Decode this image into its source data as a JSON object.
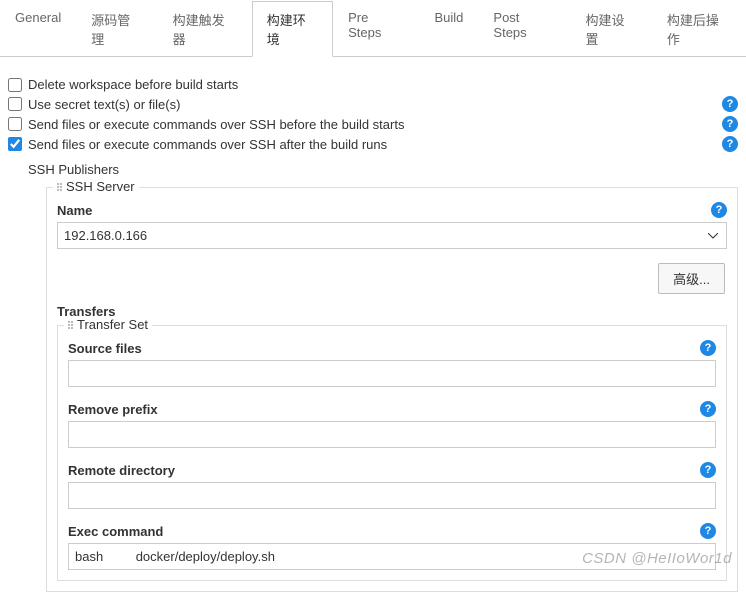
{
  "tabs": {
    "general": "General",
    "source": "源码管理",
    "triggers": "构建触发器",
    "env": "构建环境",
    "presteps": "Pre Steps",
    "build": "Build",
    "poststeps": "Post Steps",
    "settings": "构建设置",
    "postactions": "构建后操作"
  },
  "checkboxes": {
    "delete_ws": "Delete workspace before build starts",
    "use_secret": "Use secret text(s) or file(s)",
    "ssh_before": "Send files or execute commands over SSH before the build starts",
    "ssh_after": "Send files or execute commands over SSH after the build runs"
  },
  "ssh": {
    "publishers_title": "SSH Publishers",
    "server_legend": "SSH Server",
    "name_label": "Name",
    "name_value": "192.168.0.166",
    "advanced_btn": "高级...",
    "transfers_title": "Transfers",
    "transfer_set_legend": "Transfer Set",
    "source_files_label": "Source files",
    "source_files_value": "",
    "remove_prefix_label": "Remove prefix",
    "remove_prefix_value": "",
    "remote_dir_label": "Remote directory",
    "remote_dir_value": "",
    "exec_label": "Exec command",
    "exec_value": "bash         docker/deploy/deploy.sh"
  },
  "watermark": "CSDN @HeIIoWor1d",
  "help_glyph": "?"
}
